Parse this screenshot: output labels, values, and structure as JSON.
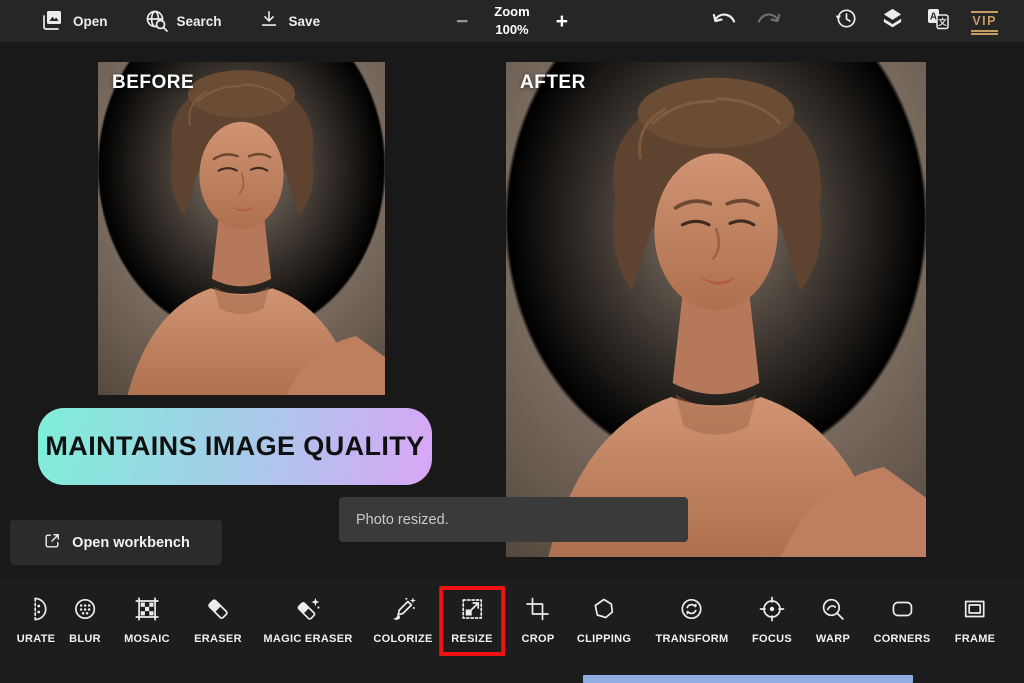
{
  "topbar": {
    "open_label": "Open",
    "search_label": "Search",
    "save_label": "Save",
    "zoom_label": "Zoom",
    "zoom_value": "100%",
    "zoom_out_glyph": "−",
    "zoom_in_glyph": "+",
    "vip_label": "VIP"
  },
  "canvas": {
    "before_label": "BEFORE",
    "after_label": "AFTER",
    "banner_text": "MAINTAINS IMAGE QUALITY",
    "workbench_label": "Open workbench",
    "toast_text": "Photo resized."
  },
  "toolbar": {
    "items": [
      {
        "label": "URATE",
        "icon": "saturate-icon",
        "highlighted": false
      },
      {
        "label": "BLUR",
        "icon": "blur-icon",
        "highlighted": false
      },
      {
        "label": "MOSAIC",
        "icon": "mosaic-icon",
        "highlighted": false
      },
      {
        "label": "ERASER",
        "icon": "eraser-icon",
        "highlighted": false
      },
      {
        "label": "MAGIC ERASER",
        "icon": "magic-eraser-icon",
        "highlighted": false
      },
      {
        "label": "COLORIZE",
        "icon": "colorize-icon",
        "highlighted": false
      },
      {
        "label": "RESIZE",
        "icon": "resize-icon",
        "highlighted": true
      },
      {
        "label": "CROP",
        "icon": "crop-icon",
        "highlighted": false
      },
      {
        "label": "CLIPPING",
        "icon": "clipping-icon",
        "highlighted": false
      },
      {
        "label": "TRANSFORM",
        "icon": "transform-icon",
        "highlighted": false
      },
      {
        "label": "FOCUS",
        "icon": "focus-icon",
        "highlighted": false
      },
      {
        "label": "WARP",
        "icon": "warp-icon",
        "highlighted": false
      },
      {
        "label": "CORNERS",
        "icon": "corners-icon",
        "highlighted": false
      },
      {
        "label": "FRAME",
        "icon": "frame-icon",
        "highlighted": false
      }
    ]
  },
  "colors": {
    "topbar_bg": "#262626",
    "canvas_bg": "#191919",
    "bottombar_bg": "#1d1d1d",
    "highlight_red": "#ee1212",
    "banner_gradient_start": "#7fefd9",
    "banner_gradient_end": "#d9a6f6",
    "scrollbar_blue": "#8fade0",
    "vip_gold": "#c79b61"
  }
}
